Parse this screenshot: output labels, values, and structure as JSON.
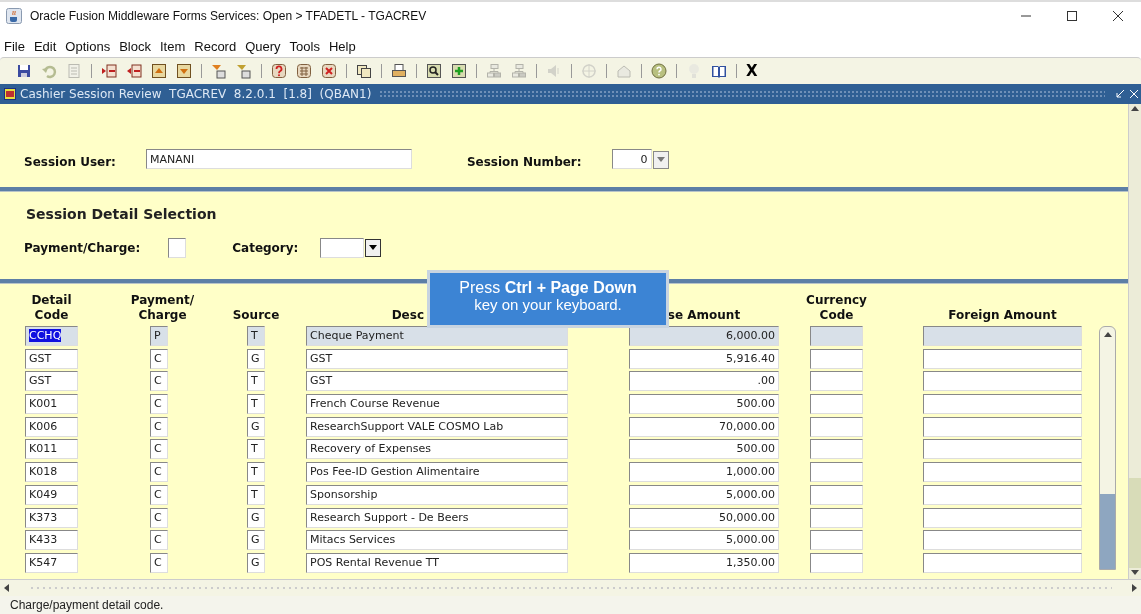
{
  "window": {
    "title": "Oracle Fusion Middleware Forms Services:  Open > TFADETL - TGACREV"
  },
  "menu": [
    "File",
    "Edit",
    "Options",
    "Block",
    "Item",
    "Record",
    "Query",
    "Tools",
    "Help"
  ],
  "toolbar": [
    {
      "kind": "save",
      "disabled": false
    },
    {
      "kind": "undo",
      "disabled": true
    },
    {
      "kind": "page",
      "disabled": true
    },
    {
      "kind": "sep"
    },
    {
      "kind": "insert",
      "disabled": false
    },
    {
      "kind": "remove",
      "disabled": false
    },
    {
      "kind": "prev",
      "disabled": false
    },
    {
      "kind": "next",
      "disabled": false
    },
    {
      "kind": "sep"
    },
    {
      "kind": "enter",
      "disabled": false
    },
    {
      "kind": "exec",
      "disabled": false
    },
    {
      "kind": "sep"
    },
    {
      "kind": "help",
      "disabled": false
    },
    {
      "kind": "grid",
      "disabled": false
    },
    {
      "kind": "cancel",
      "disabled": false
    },
    {
      "kind": "sep"
    },
    {
      "kind": "copy",
      "disabled": false
    },
    {
      "kind": "sep"
    },
    {
      "kind": "printer",
      "disabled": false
    },
    {
      "kind": "sep"
    },
    {
      "kind": "search",
      "disabled": false
    },
    {
      "kind": "add",
      "disabled": false
    },
    {
      "kind": "sep"
    },
    {
      "kind": "tree",
      "disabled": true
    },
    {
      "kind": "tree",
      "disabled": true
    },
    {
      "kind": "sep"
    },
    {
      "kind": "speaker",
      "disabled": true
    },
    {
      "kind": "sep"
    },
    {
      "kind": "target",
      "disabled": true
    },
    {
      "kind": "sep"
    },
    {
      "kind": "house",
      "disabled": true
    },
    {
      "kind": "sep"
    },
    {
      "kind": "question",
      "disabled": false
    },
    {
      "kind": "sep"
    },
    {
      "kind": "bulb",
      "disabled": true
    },
    {
      "kind": "book",
      "disabled": false
    },
    {
      "kind": "sep"
    },
    {
      "kind": "text",
      "label": "X",
      "disabled": false
    }
  ],
  "form": {
    "title": "Cashier Session Review  TGACREV  8.2.0.1  [1.8]  (QBAN1)"
  },
  "key_block": {
    "session_user_label": "Session User:",
    "session_user": "MANANI",
    "session_number_label": "Session Number:",
    "session_number": "0"
  },
  "selection": {
    "title": "Session Detail Selection",
    "payment_charge_label": "Payment/Charge:",
    "category_label": "Category:"
  },
  "table": {
    "columns": [
      "Detail\nCode",
      "Payment/\nCharge",
      "Source",
      "Desc",
      "se Amount",
      "Currency\nCode",
      "Foreign Amount"
    ],
    "rows": [
      {
        "detail_code": "CCHQ",
        "payment_charge": "P",
        "source": "T",
        "description": "Cheque Payment",
        "base_amount": "6,000.00",
        "selected": true
      },
      {
        "detail_code": "GST",
        "payment_charge": "C",
        "source": "G",
        "description": "GST",
        "base_amount": "5,916.40",
        "selected": false
      },
      {
        "detail_code": "GST",
        "payment_charge": "C",
        "source": "T",
        "description": "GST",
        "base_amount": ".00",
        "selected": false
      },
      {
        "detail_code": "K001",
        "payment_charge": "C",
        "source": "T",
        "description": "French Course Revenue",
        "base_amount": "500.00",
        "selected": false
      },
      {
        "detail_code": "K006",
        "payment_charge": "C",
        "source": "G",
        "description": "ResearchSupport VALE COSMO Lab",
        "base_amount": "70,000.00",
        "selected": false
      },
      {
        "detail_code": "K011",
        "payment_charge": "C",
        "source": "T",
        "description": "Recovery of Expenses",
        "base_amount": "500.00",
        "selected": false
      },
      {
        "detail_code": "K018",
        "payment_charge": "C",
        "source": "T",
        "description": "Pos Fee-ID Gestion Alimentaire",
        "base_amount": "1,000.00",
        "selected": false
      },
      {
        "detail_code": "K049",
        "payment_charge": "C",
        "source": "T",
        "description": "Sponsorship",
        "base_amount": "5,000.00",
        "selected": false
      },
      {
        "detail_code": "K373",
        "payment_charge": "C",
        "source": "G",
        "description": "Research Support - De Beers",
        "base_amount": "50,000.00",
        "selected": false
      },
      {
        "detail_code": "K433",
        "payment_charge": "C",
        "source": "G",
        "description": "Mitacs Services",
        "base_amount": "5,000.00",
        "selected": false
      },
      {
        "detail_code": "K547",
        "payment_charge": "C",
        "source": "G",
        "description": "POS Rental Revenue TT",
        "base_amount": "1,350.00",
        "selected": false
      }
    ]
  },
  "tooltip": {
    "line_1": "Press **Ctrl + Page Down**",
    "line_2": "key on your keyboard."
  },
  "status_bar": {
    "message": "Charge/payment detail code."
  }
}
